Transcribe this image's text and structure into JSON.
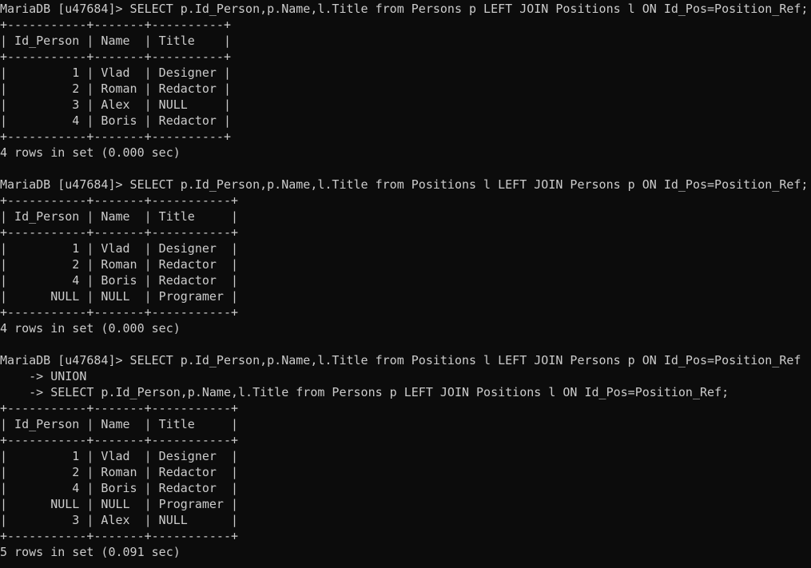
{
  "terminal": {
    "colors": {
      "background": "#0c0c0c",
      "foreground": "#cccccc"
    },
    "lines": [
      "MariaDB [u47684]> SELECT p.Id_Person,p.Name,l.Title from Persons p LEFT JOIN Positions l ON Id_Pos=Position_Ref;",
      "+-----------+-------+----------+",
      "| Id_Person | Name  | Title    |",
      "+-----------+-------+----------+",
      "|         1 | Vlad  | Designer |",
      "|         2 | Roman | Redactor |",
      "|         3 | Alex  | NULL     |",
      "|         4 | Boris | Redactor |",
      "+-----------+-------+----------+",
      "4 rows in set (0.000 sec)",
      "",
      "MariaDB [u47684]> SELECT p.Id_Person,p.Name,l.Title from Positions l LEFT JOIN Persons p ON Id_Pos=Position_Ref;",
      "+-----------+-------+-----------+",
      "| Id_Person | Name  | Title     |",
      "+-----------+-------+-----------+",
      "|         1 | Vlad  | Designer  |",
      "|         2 | Roman | Redactor  |",
      "|         4 | Boris | Redactor  |",
      "|      NULL | NULL  | Programer |",
      "+-----------+-------+-----------+",
      "4 rows in set (0.000 sec)",
      "",
      "MariaDB [u47684]> SELECT p.Id_Person,p.Name,l.Title from Positions l LEFT JOIN Persons p ON Id_Pos=Position_Ref",
      "    -> UNION",
      "    -> SELECT p.Id_Person,p.Name,l.Title from Persons p LEFT JOIN Positions l ON Id_Pos=Position_Ref;",
      "+-----------+-------+-----------+",
      "| Id_Person | Name  | Title     |",
      "+-----------+-------+-----------+",
      "|         1 | Vlad  | Designer  |",
      "|         2 | Roman | Redactor  |",
      "|         4 | Boris | Redactor  |",
      "|      NULL | NULL  | Programer |",
      "|         3 | Alex  | NULL      |",
      "+-----------+-------+-----------+",
      "5 rows in set (0.091 sec)"
    ]
  }
}
